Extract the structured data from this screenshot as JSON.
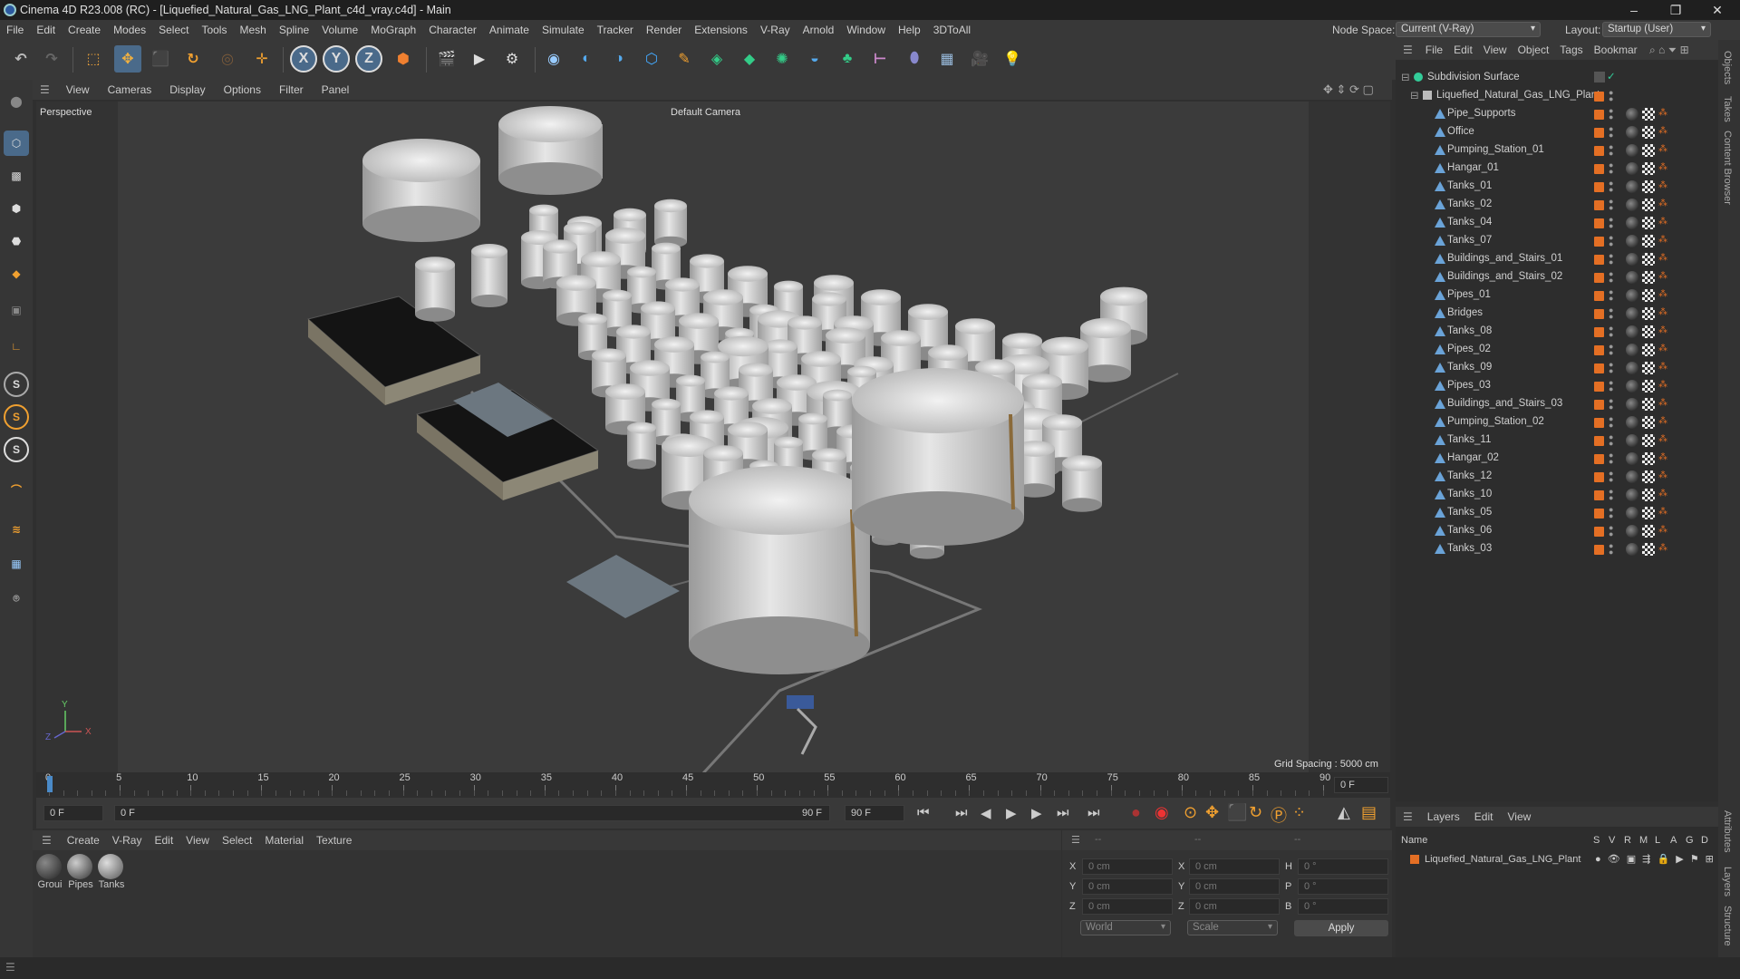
{
  "app": {
    "title": "Cinema 4D R23.008 (RC) - [Liquefied_Natural_Gas_LNG_Plant_c4d_vray.c4d] - Main"
  },
  "menu": [
    "File",
    "Edit",
    "Create",
    "Modes",
    "Select",
    "Tools",
    "Mesh",
    "Spline",
    "Volume",
    "MoGraph",
    "Character",
    "Animate",
    "Simulate",
    "Tracker",
    "Render",
    "Extensions",
    "V-Ray",
    "Arnold",
    "Window",
    "Help",
    "3DToAll"
  ],
  "nodespace": {
    "label": "Node Space:",
    "value": "Current (V-Ray)"
  },
  "layout": {
    "label": "Layout:",
    "value": "Startup (User)"
  },
  "viewport": {
    "menu": [
      "View",
      "Cameras",
      "Display",
      "Options",
      "Filter",
      "Panel"
    ],
    "label": "Perspective",
    "camera": "Default Camera",
    "grid": "Grid Spacing : 5000 cm"
  },
  "timeline": {
    "ticks": [
      "0",
      "5",
      "10",
      "15",
      "20",
      "25",
      "30",
      "35",
      "40",
      "45",
      "50",
      "55",
      "60",
      "65",
      "70",
      "75",
      "80",
      "85",
      "90"
    ],
    "end_field": "0 F"
  },
  "transport": {
    "start": "0 F",
    "current": "0 F",
    "end_range": "90 F",
    "end": "90 F"
  },
  "matpanel": {
    "menu": [
      "Create",
      "V-Ray",
      "Edit",
      "View",
      "Select",
      "Material",
      "Texture"
    ],
    "materials": [
      "Groui",
      "Pipes",
      "Tanks"
    ]
  },
  "coords": {
    "rows": [
      {
        "a": "X",
        "av": "0 cm",
        "b": "X",
        "bv": "0 cm",
        "c": "H",
        "cv": "0 °"
      },
      {
        "a": "Y",
        "av": "0 cm",
        "b": "Y",
        "bv": "0 cm",
        "c": "P",
        "cv": "0 °"
      },
      {
        "a": "Z",
        "av": "0 cm",
        "b": "Z",
        "bv": "0 cm",
        "c": "B",
        "cv": "0 °"
      }
    ],
    "mode1": "World",
    "mode2": "Scale",
    "apply": "Apply",
    "h1": "--",
    "h2": "--",
    "h3": "--"
  },
  "objmenu": [
    "File",
    "Edit",
    "View",
    "Object",
    "Tags",
    "Bookmar"
  ],
  "objects": {
    "root": "Subdivision Surface",
    "group": "Liquefied_Natural_Gas_LNG_Plant",
    "items": [
      "Pipe_Supports",
      "Office",
      "Pumping_Station_01",
      "Hangar_01",
      "Tanks_01",
      "Tanks_02",
      "Tanks_04",
      "Tanks_07",
      "Buildings_and_Stairs_01",
      "Buildings_and_Stairs_02",
      "Pipes_01",
      "Bridges",
      "Tanks_08",
      "Pipes_02",
      "Tanks_09",
      "Pipes_03",
      "Buildings_and_Stairs_03",
      "Pumping_Station_02",
      "Tanks_11",
      "Hangar_02",
      "Tanks_12",
      "Tanks_10",
      "Tanks_05",
      "Tanks_06",
      "Tanks_03"
    ]
  },
  "layers": {
    "menu": [
      "Layers",
      "Edit",
      "View"
    ],
    "header": "Name",
    "cols": [
      "S",
      "V",
      "R",
      "M",
      "L",
      "A",
      "G",
      "D"
    ],
    "items": [
      "Liquefied_Natural_Gas_LNG_Plant"
    ]
  },
  "righttabs": [
    "Objects",
    "Takes",
    "Content Browser",
    "Attributes",
    "Layers",
    "Structure"
  ],
  "colors": {
    "accent": "#e46f24",
    "bg": "#2f2f2f"
  }
}
